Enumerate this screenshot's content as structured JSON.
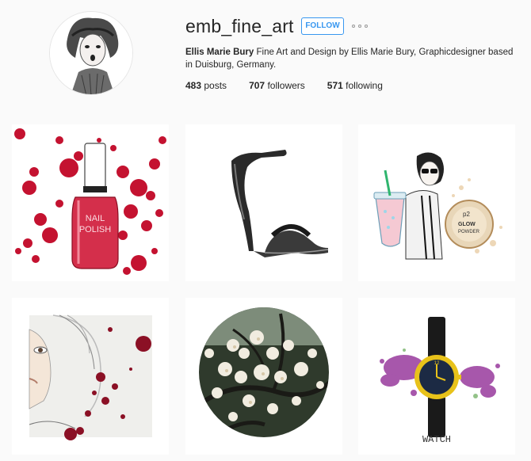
{
  "profile": {
    "username": "emb_fine_art",
    "follow_label": "FOLLOW",
    "bio_name": "Ellis Marie Bury",
    "bio_text": "Fine Art and Design by Ellis Marie Bury, Graphicdesigner based in Duisburg, Germany.",
    "stats": {
      "posts_count": "483",
      "posts_label": "posts",
      "followers_count": "707",
      "followers_label": "followers",
      "following_count": "571",
      "following_label": "following"
    }
  },
  "posts": {
    "p1": {
      "bottle_text_1": "NAIL",
      "bottle_text_2": "POLISH"
    },
    "p3": {
      "compact_brand": "p2",
      "compact_text_1": "GLOW",
      "compact_text_2": "POWDER"
    },
    "p6": {
      "caption": "WATCH"
    }
  },
  "colors": {
    "accent": "#3897f0",
    "splatter_red": "#c41230",
    "watch_purple": "#8a1f8f",
    "watch_gold": "#e8c21a"
  },
  "icons": {
    "more": "ellipsis-icon"
  }
}
